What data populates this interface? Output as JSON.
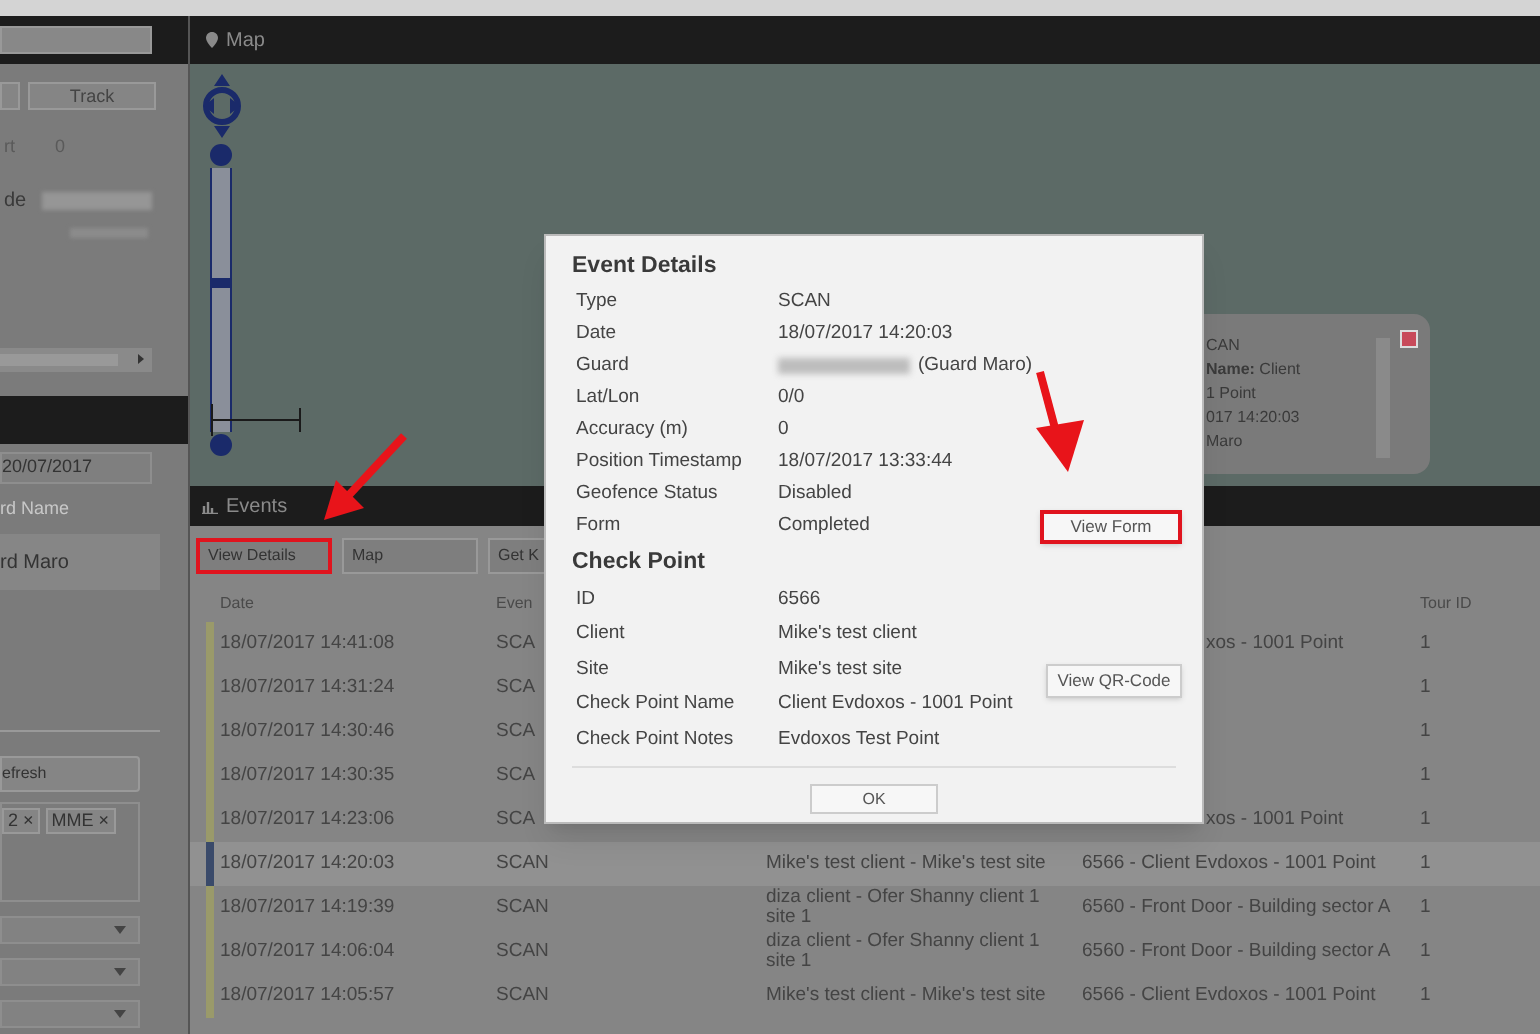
{
  "sidebar": {
    "track_button": "Track",
    "stat_label": "rt",
    "stat_value": "0",
    "mode_label": "de",
    "date_field": "20/07/2017",
    "guard_label": "rd Name",
    "guard_item": "rd Maro",
    "refresh_button": "efresh",
    "tags": [
      "2 ×",
      "MME ×"
    ]
  },
  "map": {
    "title": "Map",
    "zoom": {
      "level": 0.57
    },
    "popup_lines": [
      "CAN",
      "**Name:** Client",
      "1 Point",
      "017 14:20:03",
      "Maro"
    ]
  },
  "events": {
    "title": "Events",
    "buttons": [
      {
        "label": "View Details",
        "highlighted": true
      },
      {
        "label": "Map",
        "highlighted": false
      },
      {
        "label": "Get K",
        "highlighted": false
      }
    ],
    "columns": {
      "date": "Date",
      "event": "Even",
      "tour_id": "Tour ID"
    },
    "rows": [
      {
        "date": "18/07/2017 14:41:08",
        "event": "SCA",
        "checkpoint": "xos - 1001 Point",
        "tour_id": "1",
        "selected": false
      },
      {
        "date": "18/07/2017 14:31:24",
        "event": "SCA",
        "tour_id": "1",
        "selected": false
      },
      {
        "date": "18/07/2017 14:30:46",
        "event": "SCA",
        "tour_id": "1",
        "selected": false
      },
      {
        "date": "18/07/2017 14:30:35",
        "event": "SCA",
        "tour_id": "1",
        "selected": false
      },
      {
        "date": "18/07/2017 14:23:06",
        "event": "SCA",
        "checkpoint": "xos - 1001 Point",
        "tour_id": "1",
        "selected": false
      },
      {
        "date": "18/07/2017 14:20:03",
        "event": "SCAN",
        "client": "Mike's test client - Mike's test site",
        "checkpoint": "6566 - Client Evdoxos - 1001 Point",
        "tour_id": "1",
        "selected": true
      },
      {
        "date": "18/07/2017 14:19:39",
        "event": "SCAN",
        "client": "diza client - Ofer Shanny client 1 site 1",
        "checkpoint": "6560 - Front Door - Building sector A",
        "tour_id": "1",
        "selected": false
      },
      {
        "date": "18/07/2017 14:06:04",
        "event": "SCAN",
        "client": "diza client - Ofer Shanny client 1 site 1",
        "checkpoint": "6560 - Front Door - Building sector A",
        "tour_id": "1",
        "selected": false
      },
      {
        "date": "18/07/2017 14:05:57",
        "event": "SCAN",
        "client": "Mike's test client - Mike's test site",
        "checkpoint": "6566 - Client Evdoxos - 1001 Point",
        "tour_id": "1",
        "selected": false
      }
    ]
  },
  "modal": {
    "sections": [
      {
        "title": "Event Details",
        "rows": [
          {
            "label": "Type",
            "value": "SCAN"
          },
          {
            "label": "Date",
            "value": "18/07/2017 14:20:03"
          },
          {
            "label": "Guard",
            "value": "(Guard Maro)",
            "redacted": true
          },
          {
            "label": "Lat/Lon",
            "value": "0/0"
          },
          {
            "label": "Accuracy (m)",
            "value": "0"
          },
          {
            "label": "Position Timestamp",
            "value": "18/07/2017 13:33:44"
          },
          {
            "label": "Geofence Status",
            "value": "Disabled"
          },
          {
            "label": "Form",
            "value": "Completed",
            "button": {
              "label": "View Form",
              "highlighted": true
            }
          }
        ]
      },
      {
        "title": "Check Point",
        "rows": [
          {
            "label": "ID",
            "value": "6566"
          },
          {
            "label": "Client",
            "value": "Mike's test client"
          },
          {
            "label": "Site",
            "value": "Mike's test site",
            "button": {
              "label": "View QR-Code",
              "highlighted": false
            }
          },
          {
            "label": "Check Point Name",
            "value": "Client Evdoxos - 1001 Point"
          },
          {
            "label": "Check Point Notes",
            "value": "Evdoxos Test Point"
          }
        ]
      }
    ],
    "ok_button": "OK"
  }
}
